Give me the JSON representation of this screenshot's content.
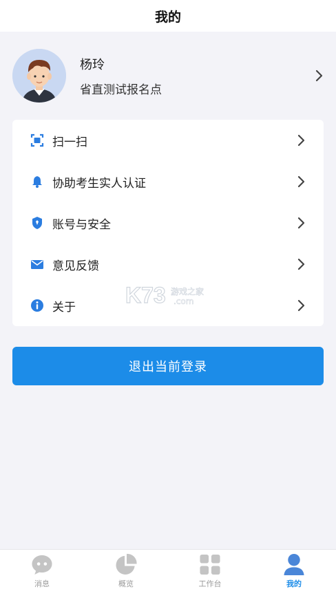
{
  "header": {
    "title": "我的"
  },
  "profile": {
    "name": "杨玲",
    "org": "省直测试报名点"
  },
  "menu": [
    {
      "label": "扫一扫",
      "icon": "scan-icon"
    },
    {
      "label": "协助考生实人认证",
      "icon": "bell-icon"
    },
    {
      "label": "账号与安全",
      "icon": "shield-icon"
    },
    {
      "label": "意见反馈",
      "icon": "mail-icon"
    },
    {
      "label": "关于",
      "icon": "info-icon"
    }
  ],
  "logout": {
    "label": "退出当前登录"
  },
  "watermark": {
    "brand": "K73",
    "text": "游戏之家",
    "domain": ".com"
  },
  "tabbar": [
    {
      "label": "消息",
      "icon": "message-icon",
      "active": false
    },
    {
      "label": "概览",
      "icon": "pie-icon",
      "active": false
    },
    {
      "label": "工作台",
      "icon": "grid-icon",
      "active": false
    },
    {
      "label": "我的",
      "icon": "person-icon",
      "active": true
    }
  ],
  "colors": {
    "accent": "#1c8ce8",
    "background": "#f3f3f8",
    "inactive": "#b8b8b8"
  }
}
